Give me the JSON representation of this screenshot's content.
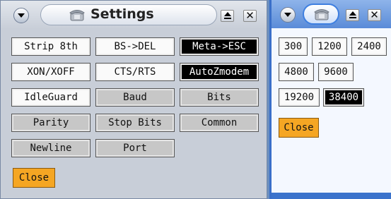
{
  "settings_window": {
    "title": "Settings",
    "buttons": [
      {
        "label": "Strip 8th",
        "style": "white"
      },
      {
        "label": "BS->DEL",
        "style": "white"
      },
      {
        "label": "Meta->ESC",
        "style": "black"
      },
      {
        "label": "XON/XOFF",
        "style": "white"
      },
      {
        "label": "CTS/RTS",
        "style": "white"
      },
      {
        "label": "AutoZmodem",
        "style": "black"
      },
      {
        "label": "IdleGuard",
        "style": "white"
      },
      {
        "label": "Baud",
        "style": "gray"
      },
      {
        "label": "Bits",
        "style": "gray"
      },
      {
        "label": "Parity",
        "style": "gray"
      },
      {
        "label": "Stop Bits",
        "style": "gray"
      },
      {
        "label": "Common",
        "style": "gray"
      },
      {
        "label": "Newline",
        "style": "gray"
      },
      {
        "label": "Port",
        "style": "gray"
      }
    ],
    "close_label": "Close"
  },
  "baud_window": {
    "rates": [
      {
        "label": "300",
        "selected": false
      },
      {
        "label": "1200",
        "selected": false
      },
      {
        "label": "2400",
        "selected": false
      },
      {
        "label": "4800",
        "selected": false
      },
      {
        "label": "9600",
        "selected": false
      },
      {
        "label": "19200",
        "selected": false
      },
      {
        "label": "38400",
        "selected": true
      }
    ],
    "close_label": "Close"
  },
  "icons": [
    "menu-icon",
    "phone-icon",
    "shade-icon",
    "close-icon"
  ],
  "colors": {
    "accent": "#f5a623",
    "selected": "#000000",
    "active_border": "#3a6fc8"
  }
}
